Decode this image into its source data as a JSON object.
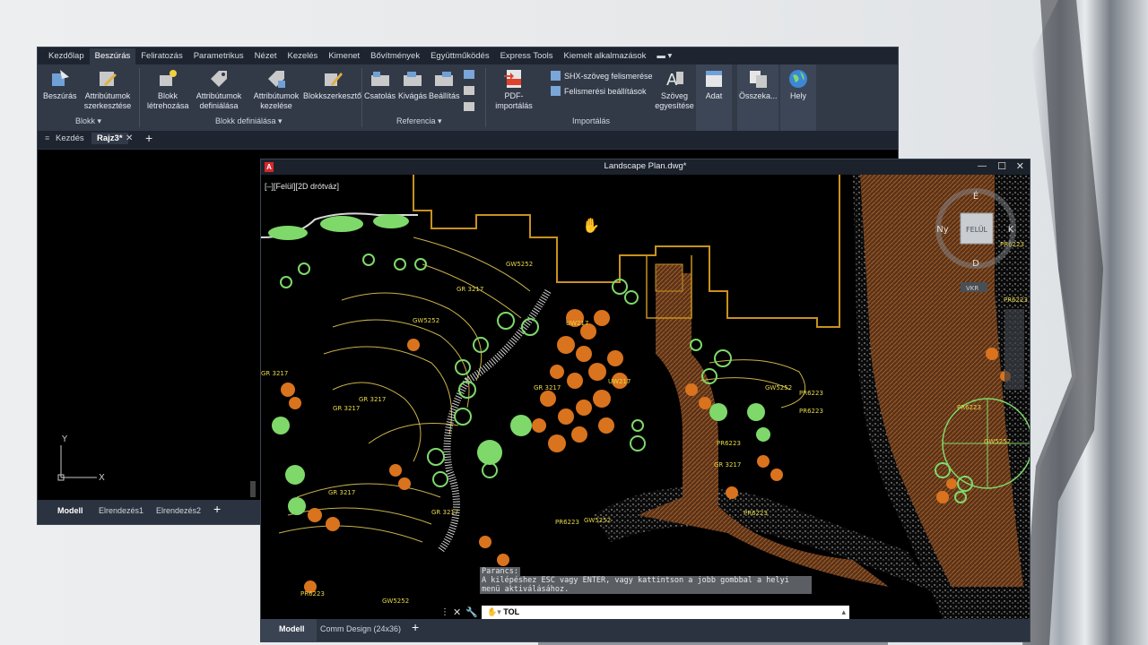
{
  "back_window": {
    "menu": [
      "Kezdőlap",
      "Beszúrás",
      "Feliratozás",
      "Parametrikus",
      "Nézet",
      "Kezelés",
      "Kimenet",
      "Bővítmények",
      "Együttműködés",
      "Express Tools",
      "Kiemelt alkalmazások"
    ],
    "menu_active": "Beszúrás",
    "ribbon": {
      "btn_beszuras": "Beszúrás",
      "btn_attr_szerk": "Attribútumok szerkesztése",
      "btn_blokk_letre": "Blokk létrehozása",
      "btn_attr_def": "Attribútumok definiálása",
      "btn_attr_kez": "Attribútumok kezelése",
      "btn_blokkszerk": "Blokkszerkesztő",
      "btn_csatolas": "Csatolás",
      "btn_kivagas": "Kivágás",
      "btn_beallitas": "Beállítás",
      "btn_pdf": "PDF-importálás",
      "shx": "SHX-szöveg felismerése",
      "felismeresi": "Felismerési beállítások",
      "btn_szoveg": "Szöveg egyesítése",
      "btn_adat": "Adat",
      "btn_osszeka": "Összeka...",
      "btn_hely": "Hely",
      "grp_blokk": "Blokk ▾",
      "grp_blokkdef": "Blokk definiálása ▾",
      "grp_referencia": "Referencia ▾",
      "grp_importalas": "Importálás"
    },
    "tabs": {
      "home": "Kezdés",
      "active": "Rajz3*"
    },
    "ucs": {
      "x": "X",
      "y": "Y"
    },
    "layout_tabs": [
      "Modell",
      "Elrendezés1",
      "Elrendezés2"
    ]
  },
  "front_window": {
    "title": "Landscape Plan.dwg*",
    "viewport_label": "[–][Felül][2D drótváz]",
    "viewcube": {
      "n": "É",
      "s": "D",
      "w": "Ny",
      "e": "K",
      "face": "FELÜL",
      "wcs": "VKR"
    },
    "labels": [
      "GW5252",
      "GR 3217",
      "GW5252",
      "GR 3217",
      "GR 3217",
      "GR 3217",
      "UW217",
      "UW217",
      "GW5252",
      "PR6223",
      "PR6223",
      "GR 3217",
      "PR6223",
      "PR6223",
      "GR 3217",
      "GR 3217",
      "GR 3217",
      "PR6223",
      "GW5252",
      "PR6223",
      "GW5252",
      "PR6223",
      "PR6223",
      "GW5252",
      "PR6223"
    ],
    "command_log": {
      "line1": "Parancs:",
      "line2": "A kilépéshez ESC vagy ENTER, vagy kattintson a jobb gombbal a helyi menü aktiválásához."
    },
    "command_input": "TOL",
    "layout_tabs": [
      "Modell",
      "Comm Design (24x36)"
    ]
  },
  "colors": {
    "ribbon": "#323a48",
    "plant_orange": "#d9731e",
    "plant_green": "#7ed96a",
    "outline_gold": "#c8911e",
    "paving": "#6b3c1c"
  }
}
